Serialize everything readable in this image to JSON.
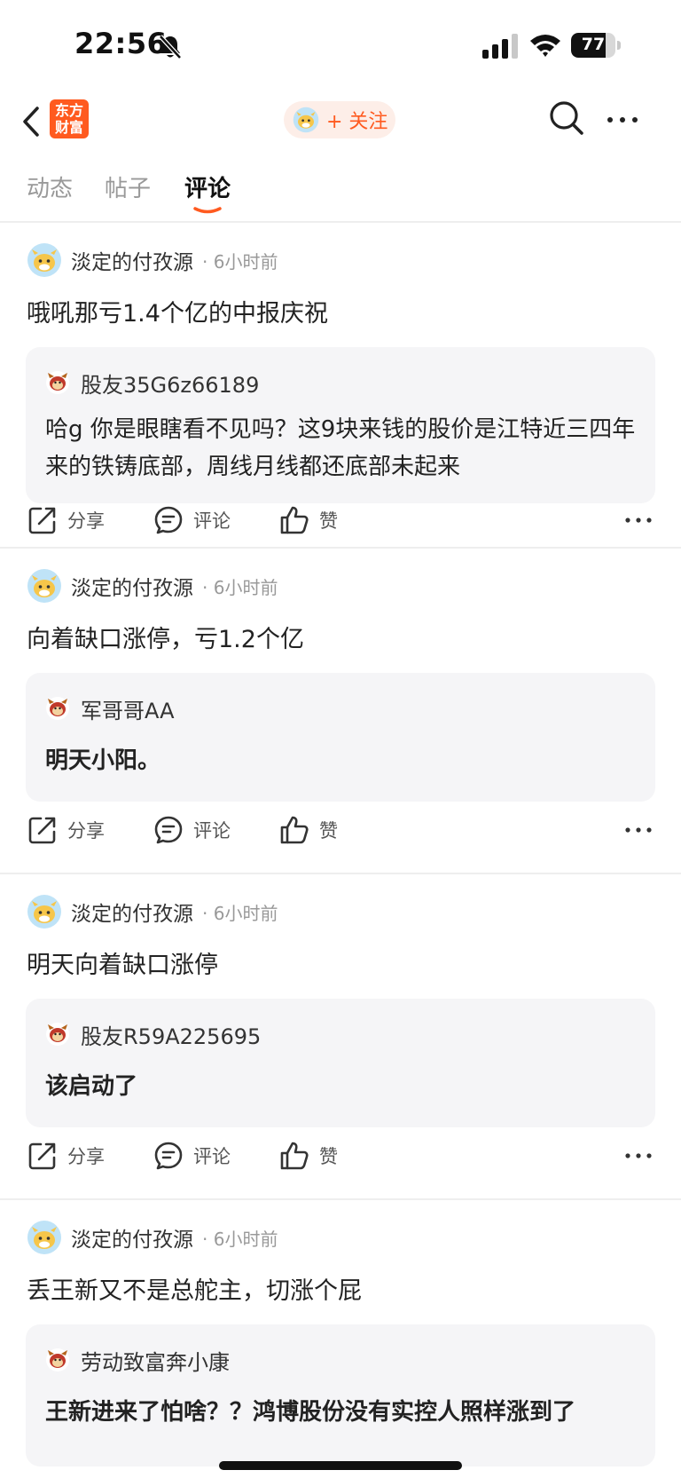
{
  "status_bar": {
    "time": "22:56",
    "battery": "77",
    "battery_level": 0.77
  },
  "nav": {
    "logo_text": "东方财富",
    "follow_label": "+ 关注"
  },
  "tabs": [
    {
      "label": "动态"
    },
    {
      "label": "帖子"
    },
    {
      "label": "评论"
    }
  ],
  "active_tab": "评论",
  "actions": {
    "share": "分享",
    "comment": "评论",
    "like": "赞"
  },
  "posts": [
    {
      "author": "淡定的付孜源",
      "time": "· 6小时前",
      "text": "哦吼那亏1.4个亿的中报庆祝",
      "quote_user": "股友35G6z66189",
      "quote_text": "哈g 你是眼瞎看不见吗？这9块来钱的股价是江特近三四年来的铁铸底部，周线月线都还底部未起来"
    },
    {
      "author": "淡定的付孜源",
      "time": "· 6小时前",
      "text": "向着缺口涨停，亏1.2个亿",
      "quote_user": "军哥哥AA",
      "quote_text": "明天小阳。"
    },
    {
      "author": "淡定的付孜源",
      "time": "· 6小时前",
      "text": "明天向着缺口涨停",
      "quote_user": "股友R59A225695",
      "quote_text": "该启动了"
    },
    {
      "author": "淡定的付孜源",
      "time": "· 6小时前",
      "text": "丢王新又不是总舵主，切涨个屁",
      "quote_user": "劳动致富奔小康",
      "quote_text": "王新进来了怕啥？？鸿博股份没有实控人照样涨到了"
    }
  ]
}
